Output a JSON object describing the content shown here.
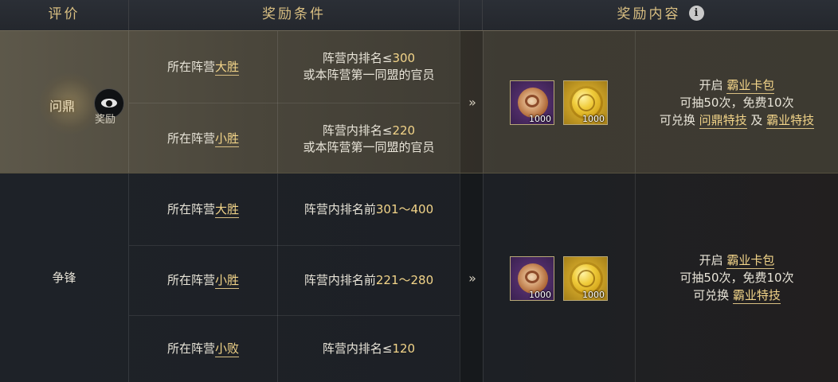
{
  "header": {
    "col_rating": "评价",
    "col_condition": "奖励条件",
    "col_content": "奖励内容",
    "info_icon": "i"
  },
  "colors": {
    "accent": "#f2d489",
    "header_text": "#d9bf82"
  },
  "tier1": {
    "rating": "问鼎",
    "view_reward_label": "奖励",
    "rows": [
      {
        "outcome_prefix": "所在阵营",
        "outcome": "大胜",
        "rank_line1_prefix": "阵营内排名≤",
        "rank_line1_num": "300",
        "rank_line2": "或本阵营第一同盟的官员"
      },
      {
        "outcome_prefix": "所在阵营",
        "outcome": "小胜",
        "rank_line1_prefix": "阵营内排名≤",
        "rank_line1_num": "220",
        "rank_line2": "或本阵营第一同盟的官员"
      }
    ],
    "arrow": "»",
    "items": [
      {
        "icon": "jade-disk-icon",
        "qty": "1000"
      },
      {
        "icon": "gold-coin-icon",
        "qty": "1000"
      }
    ],
    "desc": {
      "line1_prefix": "开启 ",
      "line1_link": "霸业卡包",
      "line2": "可抽50次，免费10次",
      "line3_prefix": "可兑换 ",
      "line3_link1": "问鼎特技",
      "line3_mid": " 及 ",
      "line3_link2": "霸业特技"
    }
  },
  "tier2": {
    "rating": "争锋",
    "rows": [
      {
        "outcome_prefix": "所在阵营",
        "outcome": "大胜",
        "rank_prefix": "阵营内排名前",
        "rank_num": "301～400"
      },
      {
        "outcome_prefix": "所在阵营",
        "outcome": "小胜",
        "rank_prefix": "阵营内排名前",
        "rank_num": "221～280"
      },
      {
        "outcome_prefix": "所在阵营",
        "outcome": "小败",
        "rank_prefix": "阵营内排名≤",
        "rank_num": "120"
      }
    ],
    "arrow": "»",
    "items": [
      {
        "icon": "jade-disk-icon",
        "qty": "1000"
      },
      {
        "icon": "gold-coin-icon",
        "qty": "1000"
      }
    ],
    "desc": {
      "line1_prefix": "开启 ",
      "line1_link": "霸业卡包",
      "line2": "可抽50次，免费10次",
      "line3_prefix": "可兑换 ",
      "line3_link1": "霸业特技"
    }
  }
}
